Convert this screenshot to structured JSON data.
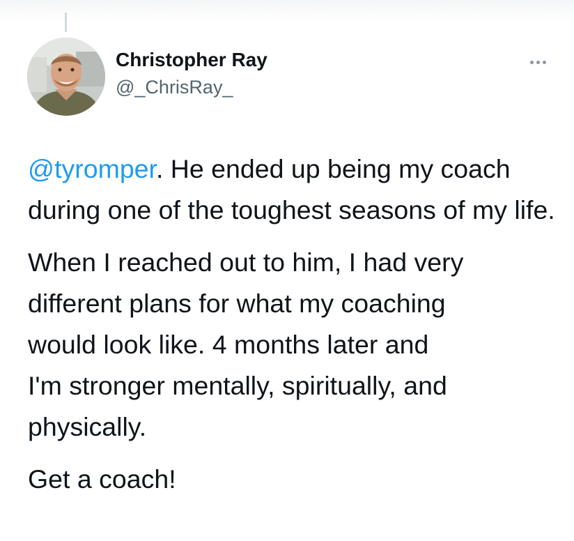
{
  "tweet": {
    "author": {
      "display_name": "Christopher Ray",
      "handle": "@_ChrisRay_",
      "avatar_icon": "profile-photo"
    },
    "more_icon": "more-horizontal-icon",
    "colors": {
      "mention": "#1d9bf0",
      "text": "#0f1419",
      "secondary": "#536471"
    },
    "paragraph_1": {
      "mention": "@tyromper",
      "text": ". He ended up being my coach during one of the toughest seasons of my life."
    },
    "paragraph_2": {
      "line_1": "When I reached out to him, I had very",
      "line_2": "different plans for what my coaching",
      "line_3": "would look like. 4 months later and",
      "line_4": "I'm stronger mentally, spiritually, and",
      "line_5": "physically."
    },
    "paragraph_3": {
      "text": "Get a coach!"
    }
  }
}
